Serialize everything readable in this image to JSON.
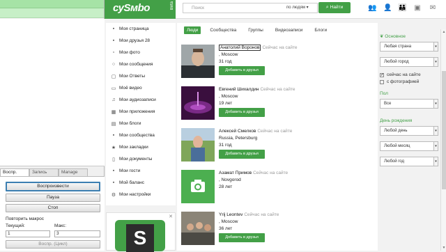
{
  "macro": {
    "tabs": [
      "Воспр.",
      "Запись",
      "Manage"
    ],
    "play_label": "Воспроизвести",
    "pause_label": "Пауза",
    "stop_label": "Стоп",
    "repeat_label": "Повторить макрос",
    "current_label": "Текущий:",
    "max_label": "Макс:",
    "current_value": "1",
    "max_value": "3",
    "loop_label": "Воспр. (Цикл)"
  },
  "site": {
    "logo": "суSмbо",
    "beta": "Beta",
    "search_placeholder": "Поиск",
    "search_mode": "по людям ▾",
    "search_button": "Найти",
    "header_icons": [
      "people-icon",
      "user-icon",
      "group-icon",
      "video-icon",
      "messages-icon",
      "settings-icon"
    ]
  },
  "nav": [
    {
      "icon": "user-icon",
      "label": "Моя страница"
    },
    {
      "icon": "friends-icon",
      "label": "Мои друзья 28"
    },
    {
      "icon": "photo-icon",
      "label": "Мои фото"
    },
    {
      "icon": "messages-icon",
      "label": "Мои сообщения"
    },
    {
      "icon": "answers-icon",
      "label": "Мои Ответы"
    },
    {
      "icon": "video-icon",
      "label": "Моё видео"
    },
    {
      "icon": "audio-icon",
      "label": "Мои аудиозаписи"
    },
    {
      "icon": "apps-icon",
      "label": "Мои приложения"
    },
    {
      "icon": "blogs-icon",
      "label": "Мои блоги"
    },
    {
      "icon": "communities-icon",
      "label": "Мои сообщества"
    },
    {
      "icon": "bookmarks-icon",
      "label": "Мои закладки"
    },
    {
      "icon": "documents-icon",
      "label": "Мои документы"
    },
    {
      "icon": "guests-icon",
      "label": "Мои гости"
    },
    {
      "icon": "balance-icon",
      "label": "Мой баланс"
    },
    {
      "icon": "settings-icon",
      "label": "Мои настройки"
    }
  ],
  "filters": [
    "Люди",
    "Сообщества",
    "Группы",
    "Видеозаписи",
    "Блоги"
  ],
  "people": [
    {
      "name": "Анатолий Воронов",
      "status": "Сейчас на сайте",
      "location": ", Moscow",
      "age": "31 год",
      "avatar": "portrait-man"
    },
    {
      "name": "Евгений Шихалдин",
      "status": "Сейчас на сайте",
      "location": ", Moscow",
      "age": "19 лет",
      "avatar": "purple-water"
    },
    {
      "name": "Алексей Смелков",
      "status": "Сейчас на сайте",
      "location": "Russia, Petersburg",
      "age": "31 год",
      "avatar": "man-outdoors"
    },
    {
      "name": "Азамат Примов",
      "status": "Сейчас на сайте",
      "location": ", Novgorod",
      "age": "28 лет",
      "avatar": "camera-placeholder"
    },
    {
      "name": "Yrij Leontev",
      "status": "Сейчас на сайте",
      "location": ", Moscow",
      "age": "36 лет",
      "avatar": "group-photo"
    }
  ],
  "add_friend_label": "Добавить в друзья",
  "search_panel": {
    "basic_label": "Основное",
    "country": "Любая страна",
    "city": "Любой город",
    "online_label": "сейчас на сайте",
    "online_checked": true,
    "photo_label": "с фотографией",
    "photo_checked": false,
    "gender_label": "Пол",
    "gender": "Все",
    "birthday_label": "День рождения",
    "day": "Любой день",
    "month": "Любой месяц",
    "year": "Любой год"
  },
  "colors": {
    "brand": "#43a047",
    "status": "#999999"
  }
}
